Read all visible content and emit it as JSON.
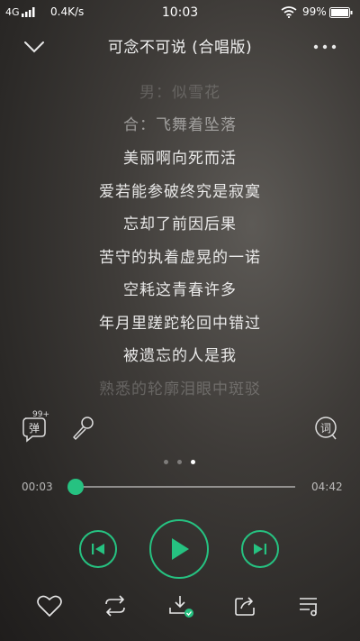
{
  "status_bar": {
    "network": "4G",
    "speed": "0.4K/s",
    "time": "10:03",
    "battery": "99%"
  },
  "header": {
    "title": "可念不可说 (合唱版)"
  },
  "lyrics": [
    "男：似雪花",
    "合：飞舞着坠落",
    "美丽啊向死而活",
    "爱若能参破终究是寂寞",
    "忘却了前因后果",
    "苦守的执着虚晃的一诺",
    "空耗这青春许多",
    "年月里蹉跎轮回中错过",
    "被遗忘的人是我",
    "熟悉的轮廓泪眼中斑驳"
  ],
  "danmu": {
    "label": "弹",
    "count": "99+"
  },
  "lyric_button_label": "词",
  "page_dots": {
    "count": 3,
    "active_index": 2
  },
  "progress": {
    "current": "00:03",
    "total": "04:42",
    "fraction": 0.011
  },
  "colors": {
    "accent": "#26c281"
  },
  "icons": {
    "back": "chevron-down-icon",
    "more": "more-dots-icon",
    "danmu": "danmu-bubble-icon",
    "mic": "microphone-icon",
    "lyric": "lyric-bubble-icon",
    "prev": "skip-previous-icon",
    "play": "play-icon",
    "next": "skip-next-icon",
    "like": "heart-icon",
    "repeat": "repeat-icon",
    "download": "download-icon",
    "share": "share-icon",
    "playlist": "playlist-icon"
  }
}
